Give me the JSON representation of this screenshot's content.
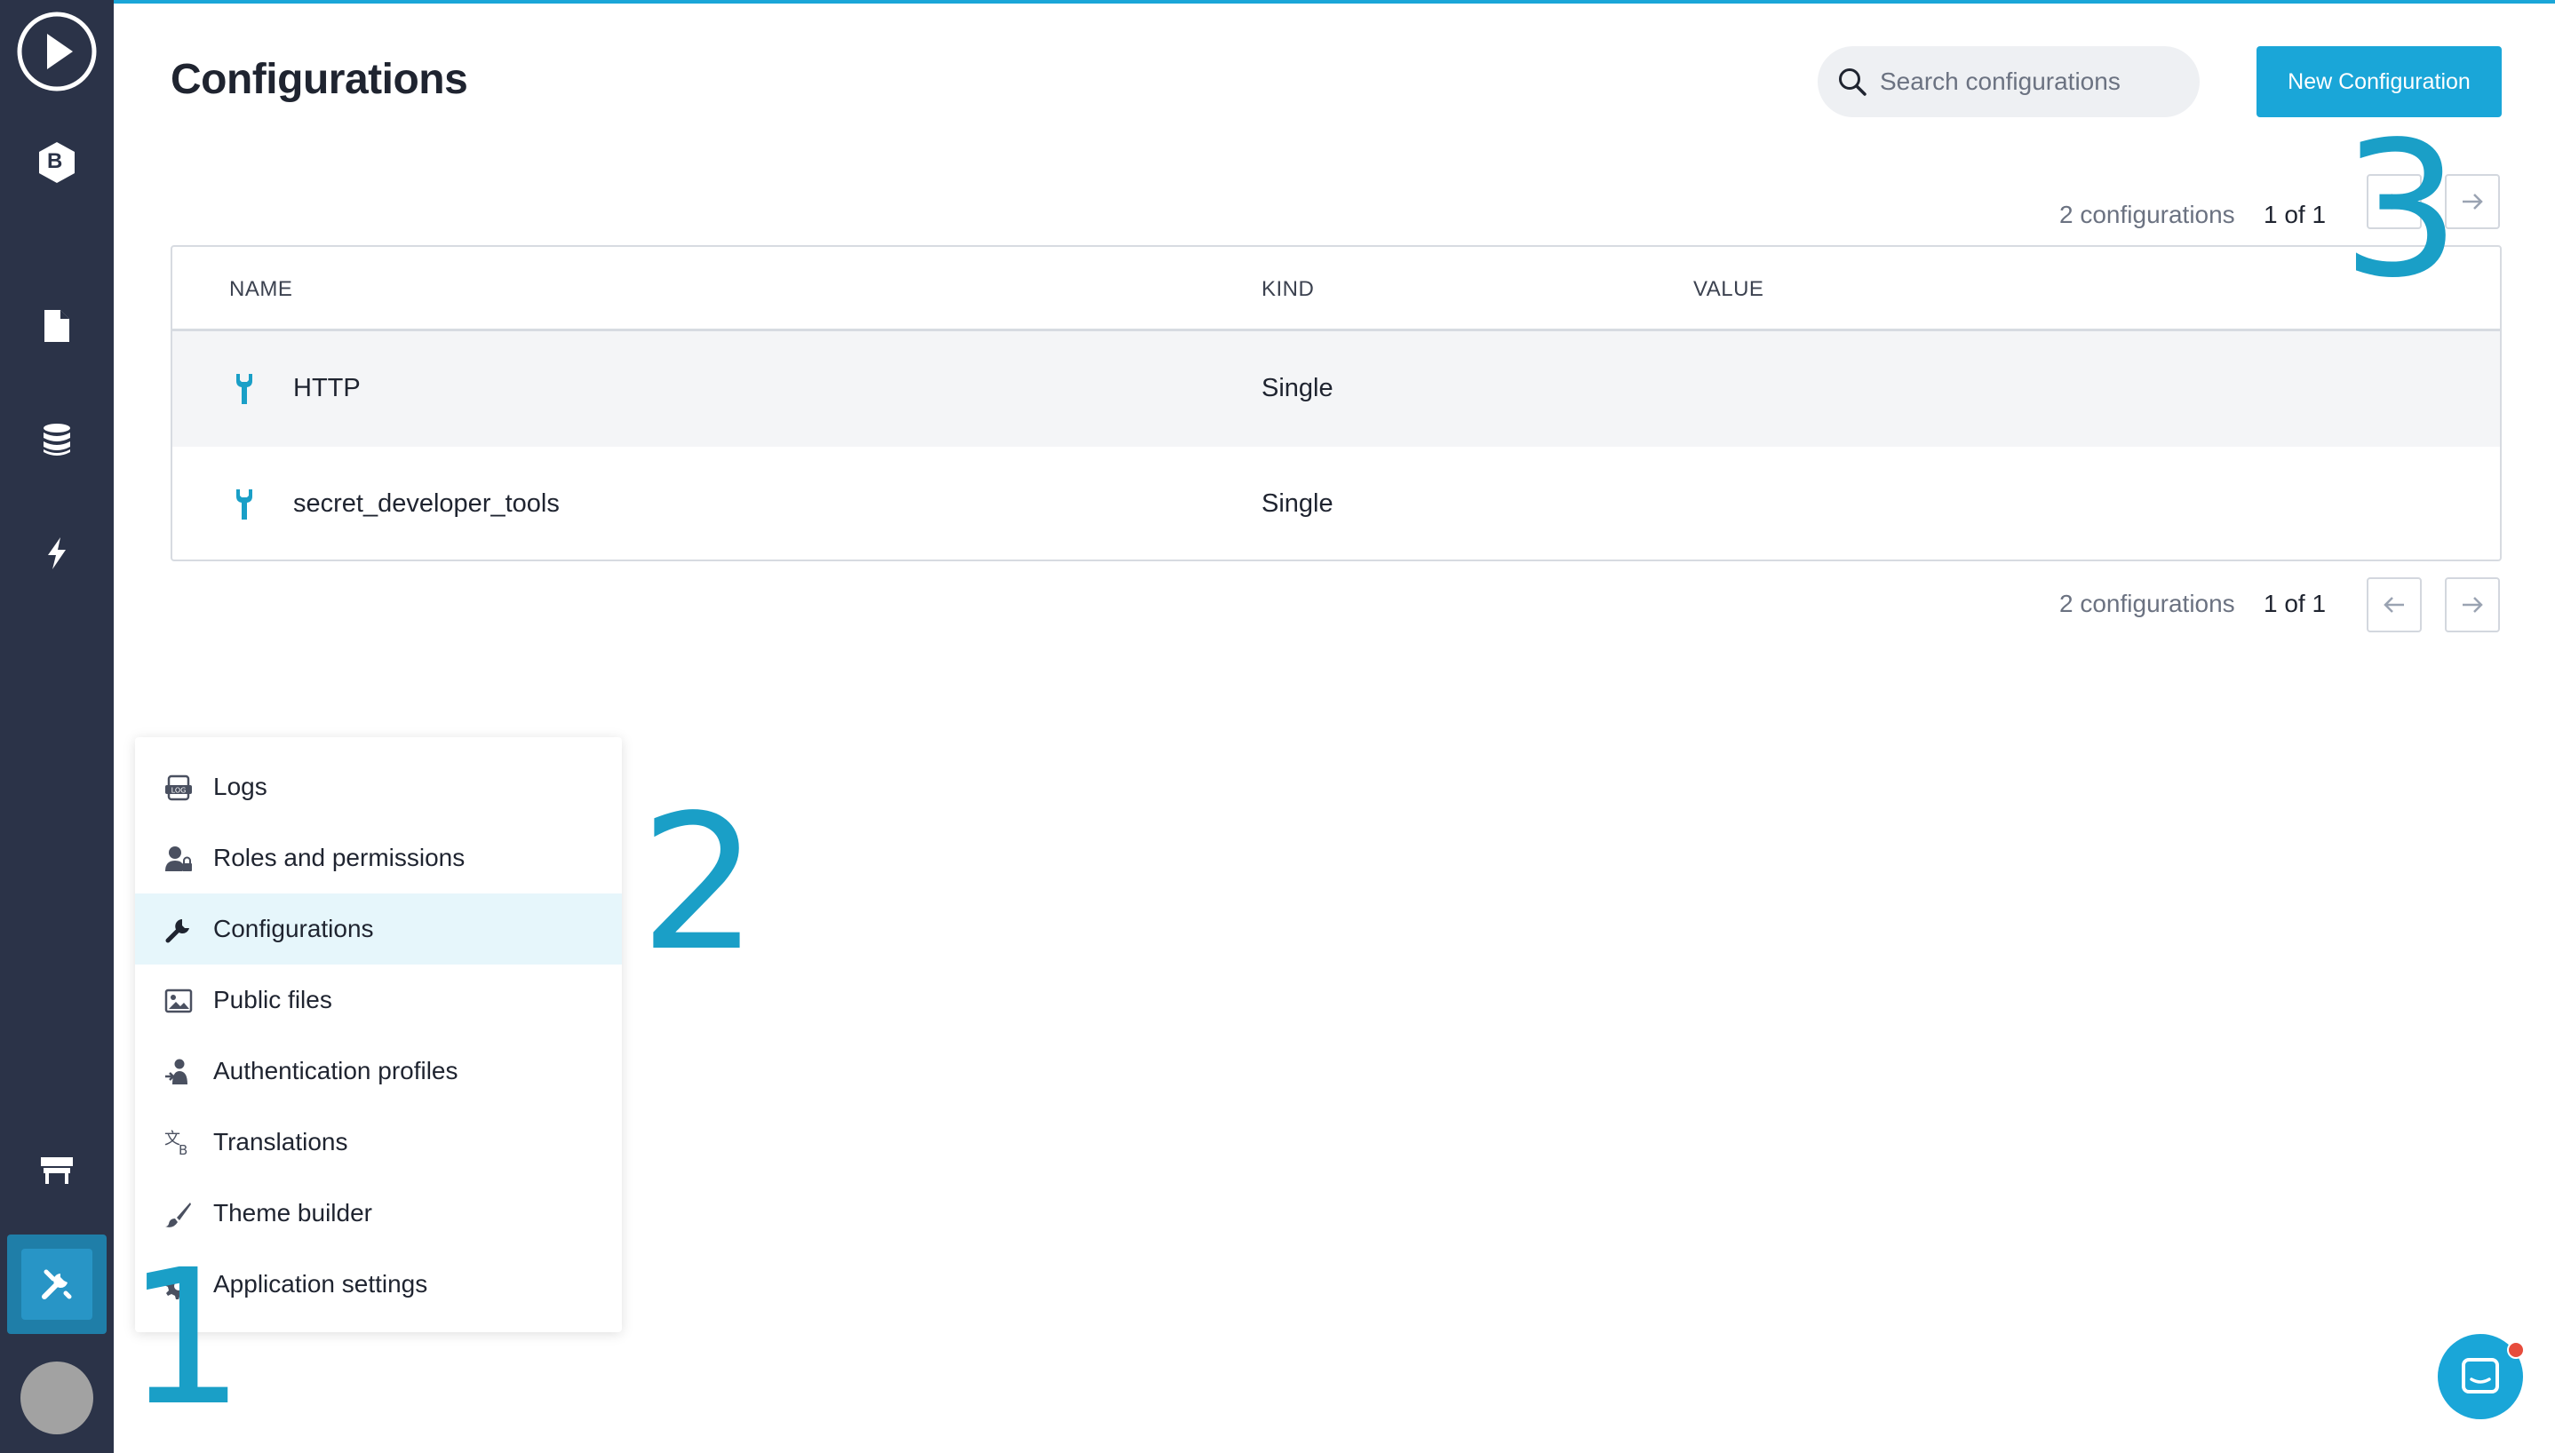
{
  "colors": {
    "accent": "#1aa6d8",
    "sidebar": "#2b3348",
    "menu_active": "#e6f6fb",
    "notification_dot": "#e74c3c"
  },
  "sidebar": {
    "items": [
      {
        "icon": "play-icon"
      },
      {
        "icon": "bettyblocks-logo-icon",
        "label": "B"
      },
      {
        "icon": "page-icon"
      },
      {
        "icon": "database-icon"
      },
      {
        "icon": "lightning-icon"
      },
      {
        "icon": "store-icon"
      },
      {
        "icon": "tools-icon",
        "active": true
      },
      {
        "icon": "avatar"
      }
    ]
  },
  "header": {
    "title": "Configurations",
    "search_placeholder": "Search configurations",
    "new_button": "New Configuration"
  },
  "pagination_top": {
    "count": "2 configurations",
    "page": "1 of 1"
  },
  "pagination_bottom": {
    "count": "2 configurations",
    "page": "1 of 1"
  },
  "table": {
    "columns": [
      "NAME",
      "KIND",
      "VALUE"
    ],
    "rows": [
      {
        "name": "HTTP",
        "kind": "Single",
        "value": "",
        "icon": "wrench-icon"
      },
      {
        "name": "secret_developer_tools",
        "kind": "Single",
        "value": "",
        "icon": "wrench-icon"
      }
    ]
  },
  "menu": {
    "items": [
      {
        "label": "Logs",
        "icon": "log-icon"
      },
      {
        "label": "Roles and permissions",
        "icon": "user-lock-icon"
      },
      {
        "label": "Configurations",
        "icon": "wrench-icon",
        "active": true
      },
      {
        "label": "Public files",
        "icon": "image-icon"
      },
      {
        "label": "Authentication profiles",
        "icon": "user-login-icon"
      },
      {
        "label": "Translations",
        "icon": "translate-icon"
      },
      {
        "label": "Theme builder",
        "icon": "brush-icon"
      },
      {
        "label": "Application settings",
        "icon": "gear-icon"
      }
    ]
  },
  "annotations": [
    "1",
    "2",
    "3"
  ]
}
